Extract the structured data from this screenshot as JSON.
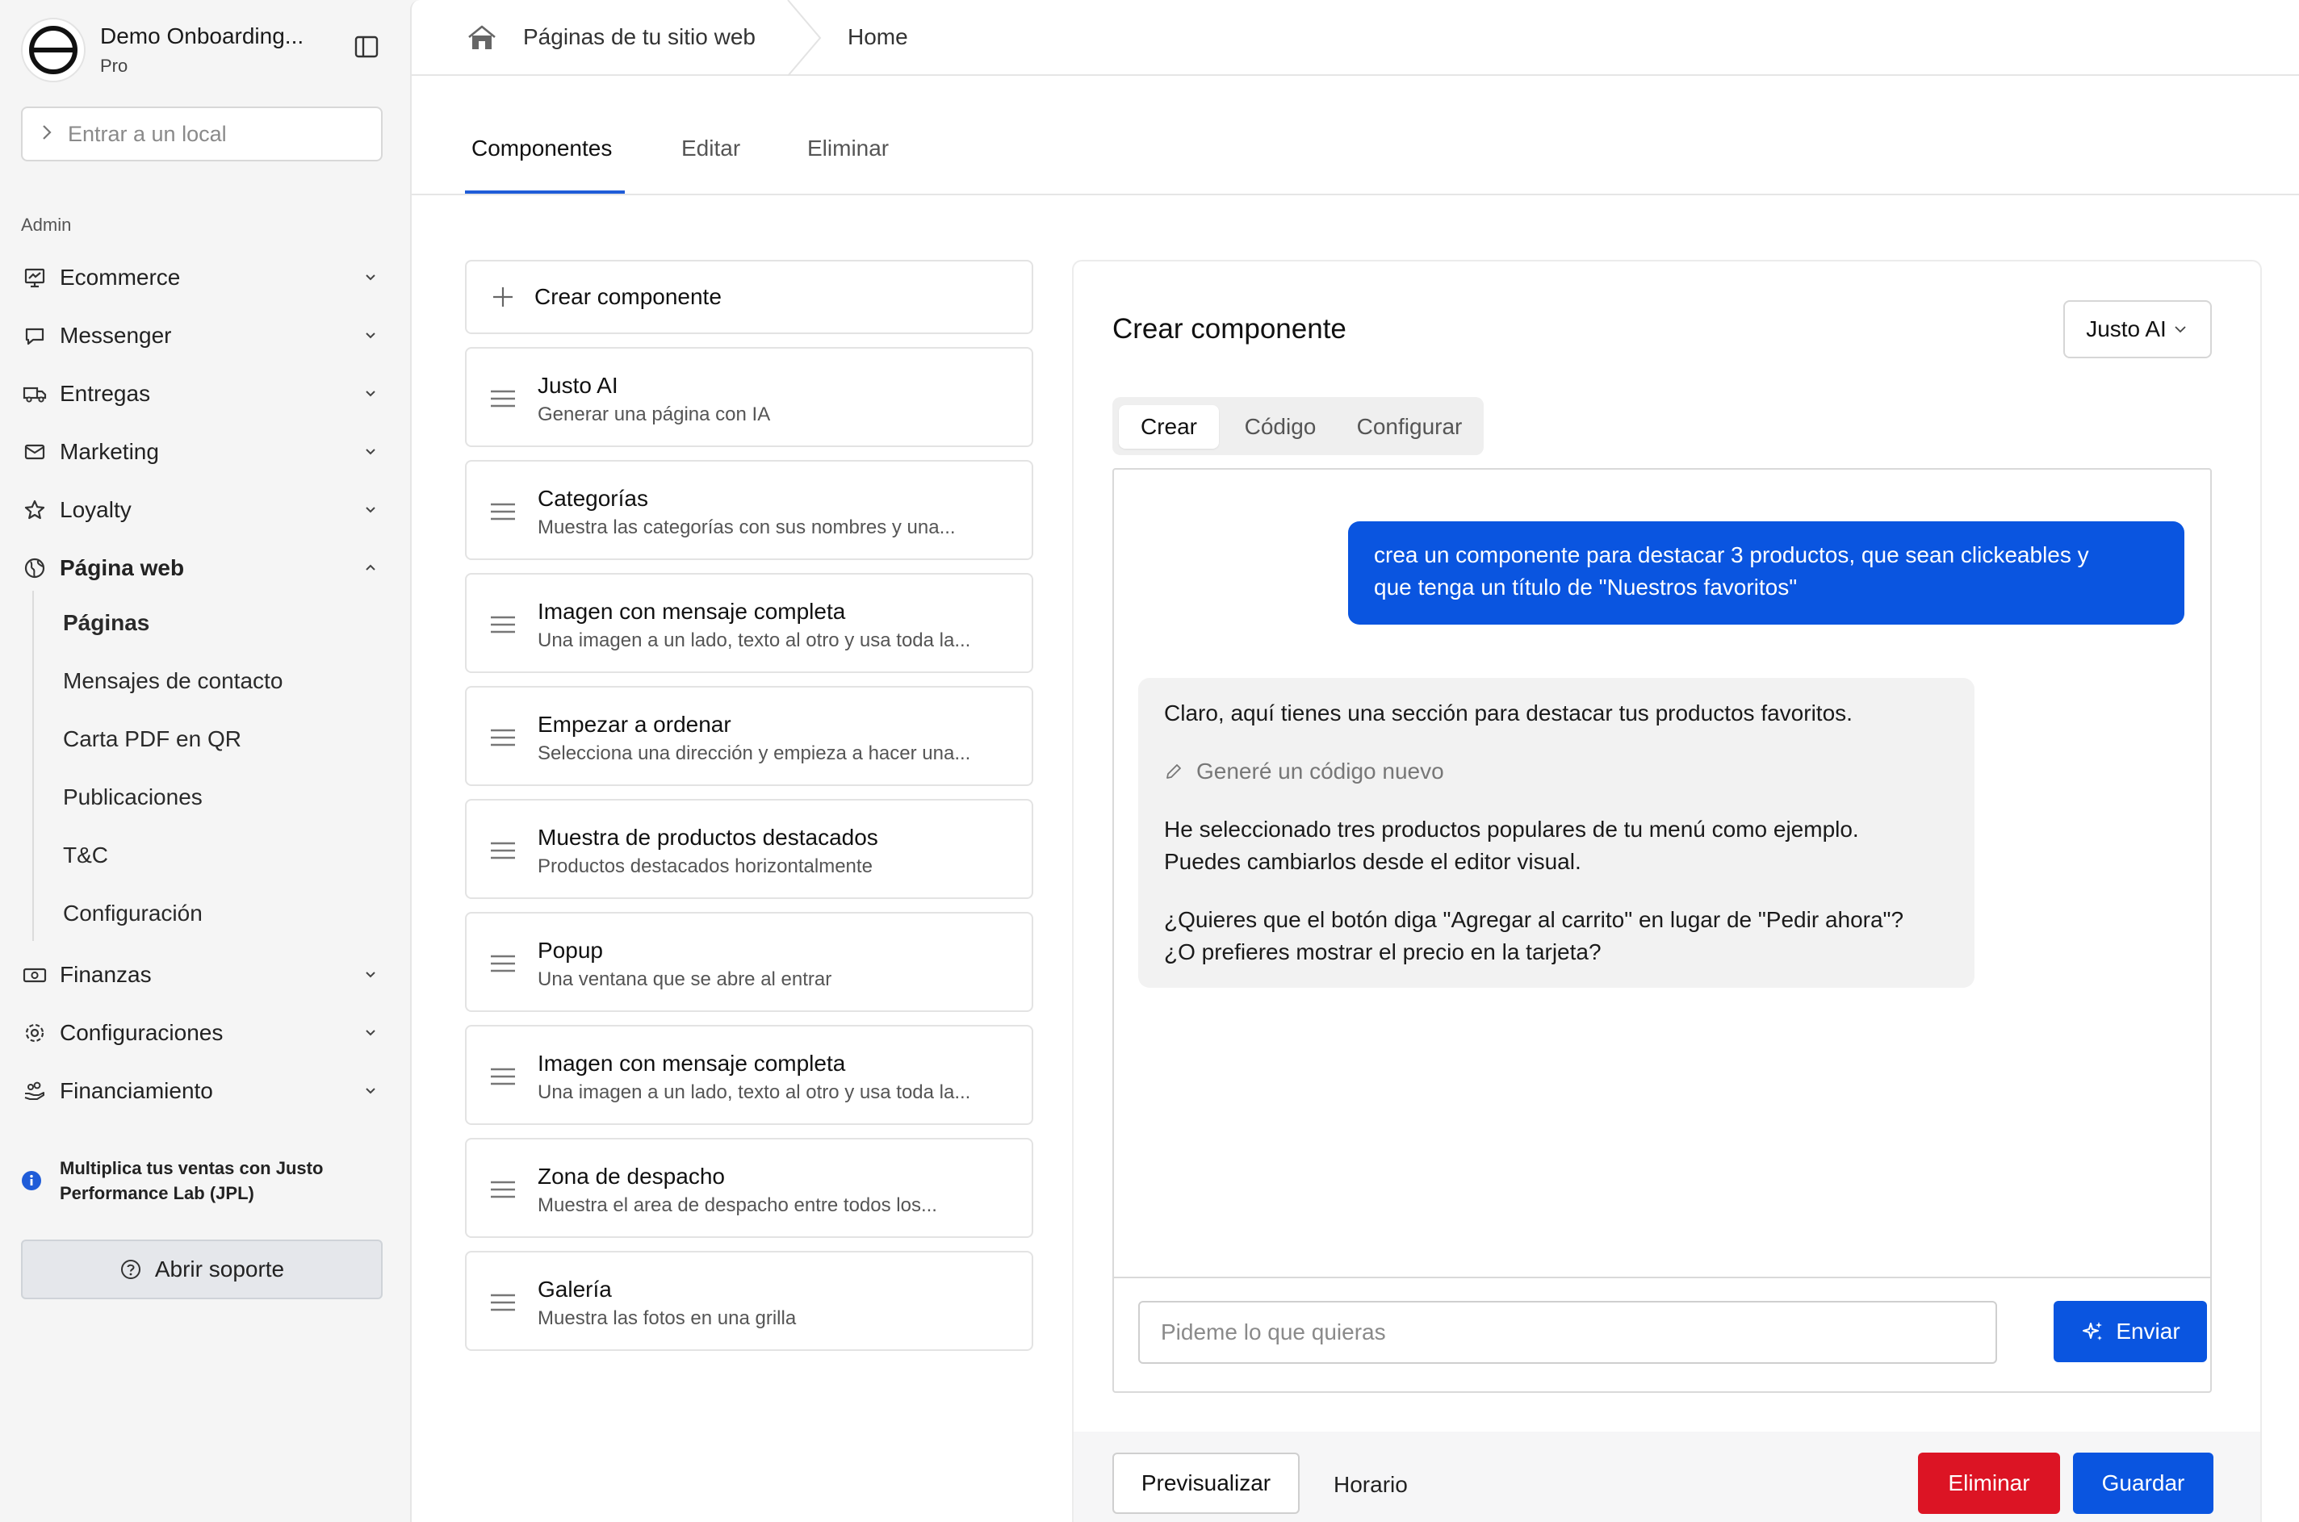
{
  "sidebar": {
    "brand_name": "Demo Onboarding...",
    "brand_plan": "Pro",
    "enter_local_placeholder": "Entrar a un local",
    "section_label": "Admin",
    "items": [
      {
        "label": "Ecommerce",
        "icon": "chart-presentation-icon"
      },
      {
        "label": "Messenger",
        "icon": "chat-bubble-icon"
      },
      {
        "label": "Entregas",
        "icon": "truck-icon"
      },
      {
        "label": "Marketing",
        "icon": "envelope-icon"
      },
      {
        "label": "Loyalty",
        "icon": "star-icon"
      },
      {
        "label": "Página web",
        "icon": "globe-icon"
      },
      {
        "label": "Finanzas",
        "icon": "banknote-icon"
      },
      {
        "label": "Configuraciones",
        "icon": "gear-icon"
      },
      {
        "label": "Financiamiento",
        "icon": "hand-coins-icon"
      }
    ],
    "subitems": [
      "Páginas",
      "Mensajes de contacto",
      "Carta PDF en QR",
      "Publicaciones",
      "T&C",
      "Configuración"
    ],
    "promo_line1": "Multiplica tus ventas con Justo",
    "promo_line2": "Performance Lab (JPL)",
    "support_label": "Abrir soporte"
  },
  "breadcrumb": {
    "parent": "Páginas de tu sitio web",
    "current": "Home"
  },
  "tabs": [
    "Componentes",
    "Editar",
    "Eliminar"
  ],
  "components": {
    "create_label": "Crear componente",
    "items": [
      {
        "title": "Justo AI",
        "desc": "Generar una página con IA"
      },
      {
        "title": "Categorías",
        "desc": "Muestra las categorías con sus nombres y una..."
      },
      {
        "title": "Imagen con mensaje completa",
        "desc": "Una imagen a un lado, texto al otro y usa toda la..."
      },
      {
        "title": "Empezar a ordenar",
        "desc": "Selecciona una dirección y empieza a hacer una..."
      },
      {
        "title": "Muestra de productos destacados",
        "desc": "Productos destacados horizontalmente"
      },
      {
        "title": "Popup",
        "desc": "Una ventana que se abre al entrar"
      },
      {
        "title": "Imagen con mensaje completa",
        "desc": "Una imagen a un lado, texto al otro y usa toda la..."
      },
      {
        "title": "Zona de despacho",
        "desc": "Muestra el area de despacho entre todos los..."
      },
      {
        "title": "Galería",
        "desc": "Muestra las fotos en una grilla"
      }
    ]
  },
  "panel": {
    "title": "Crear componente",
    "ai_select": "Justo AI",
    "segments": [
      "Crear",
      "Código",
      "Configurar"
    ],
    "user_message_line1": "crea un componente para destacar 3 productos, que sean clickeables y",
    "user_message_line2": "que tenga un título de \"Nuestros favoritos\"",
    "ai_line1": "Claro, aquí tienes una sección para destacar tus productos favoritos.",
    "ai_code_note": "Generé un código nuevo",
    "ai_line2": "He seleccionado tres productos populares de tu menú como ejemplo.",
    "ai_line3": "Puedes cambiarlos desde el editor visual.",
    "ai_line4": "¿Quieres que el botón diga \"Agregar al carrito\" en lugar de \"Pedir ahora\"?",
    "ai_line5": "¿O prefieres mostrar el precio en la tarjeta?",
    "input_placeholder": "Pideme lo que quieras",
    "send_label": "Enviar",
    "preview_label": "Previsualizar",
    "schedule_label": "Horario",
    "delete_label": "Eliminar",
    "save_label": "Guardar"
  },
  "colors": {
    "primary": "#0a55e0",
    "danger": "#dc1424"
  }
}
